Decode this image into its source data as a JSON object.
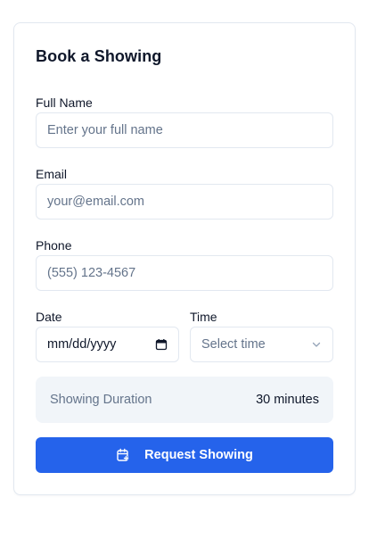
{
  "form": {
    "title": "Book a Showing",
    "full_name": {
      "label": "Full Name",
      "placeholder": "Enter your full name"
    },
    "email": {
      "label": "Email",
      "placeholder": "your@email.com"
    },
    "phone": {
      "label": "Phone",
      "placeholder": "(555) 123-4567"
    },
    "date": {
      "label": "Date",
      "placeholder": "mm/dd/yyyy"
    },
    "time": {
      "label": "Time",
      "placeholder": "Select time"
    },
    "duration": {
      "label": "Showing Duration",
      "value": "30 minutes"
    },
    "submit_label": "Request Showing"
  },
  "colors": {
    "accent": "#2563eb",
    "text": "#0f172a",
    "muted": "#64748b",
    "border": "#e2e8f0",
    "panel": "#f1f5f9"
  },
  "icons": {
    "date": "calendar-icon",
    "time": "chevron-down-icon",
    "submit": "calendar-plus-icon"
  }
}
